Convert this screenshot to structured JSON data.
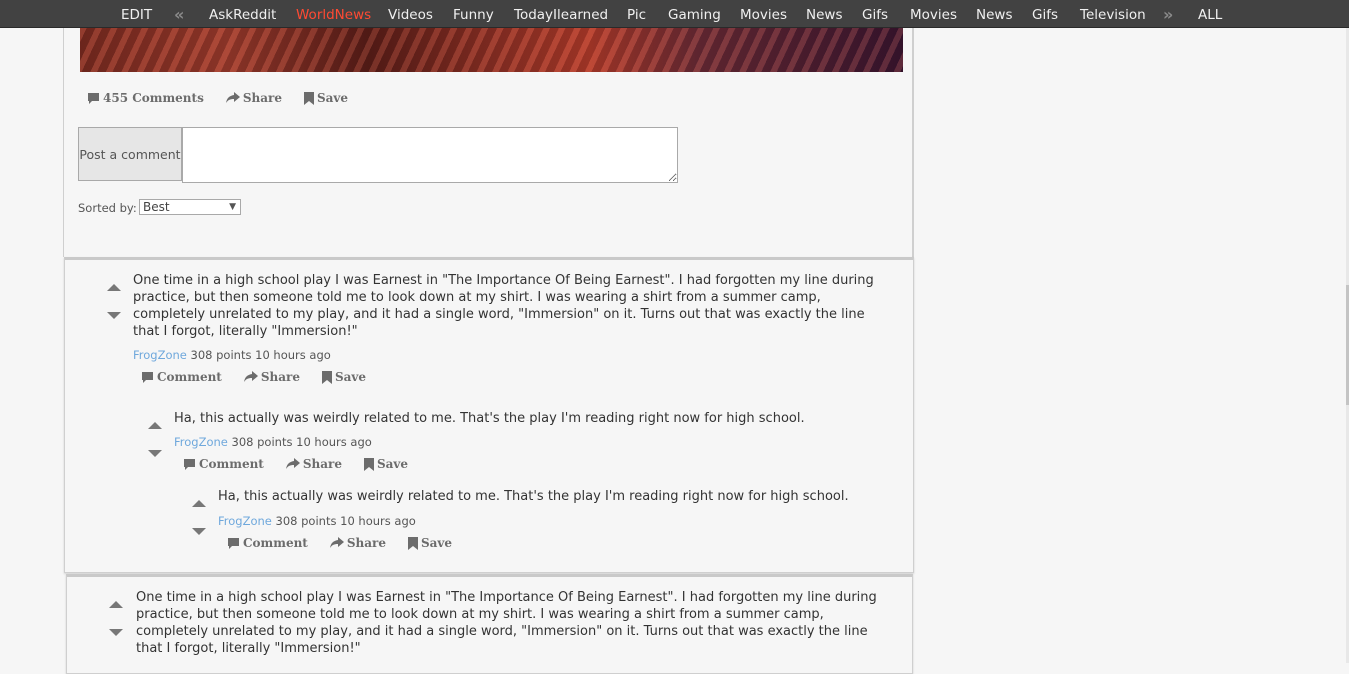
{
  "nav": {
    "edit": "EDIT",
    "prev_icon": "double-chevron-left-icon",
    "items": [
      "AskReddit",
      "WorldNews",
      "Videos",
      "Funny",
      "TodayIlearned",
      "Pic",
      "Gaming",
      "Movies",
      "News",
      "Gifs",
      "Movies",
      "News",
      "Gifs",
      "Television"
    ],
    "active_index": 1,
    "next_icon": "double-chevron-right-icon",
    "all": "ALL"
  },
  "post": {
    "actions": {
      "comments": "455 Comments",
      "share": "Share",
      "save": "Save"
    },
    "post_button": "Post a comment",
    "comment_placeholder": "",
    "sort_label": "Sorted by:",
    "sort_value": "Best"
  },
  "comments": [
    {
      "text": "One time in a high school play I was Earnest in \"The Importance Of Being Earnest\". I had forgotten my line during practice, but then someone told me to look down at my shirt. I was wearing a shirt from a summer camp, completely unrelated to my play, and it had a single word, \"Immersion\" on it. Turns out that was exactly the line that I forgot, literally \"Immersion!\"",
      "author": "FrogZone",
      "points": "308 points",
      "time": "10 hours ago",
      "actions": {
        "comment": "Comment",
        "share": "Share",
        "save": "Save"
      },
      "replies": [
        {
          "text": "Ha, this actually was weirdly related to me. That's the play I'm reading right now for high school.",
          "author": "FrogZone",
          "points": "308 points",
          "time": "10 hours ago",
          "actions": {
            "comment": "Comment",
            "share": "Share",
            "save": "Save"
          },
          "replies": [
            {
              "text": "Ha, this actually was weirdly related to me. That's the play I'm reading right now for high school.",
              "author": "FrogZone",
              "points": "308 points",
              "time": "10 hours ago",
              "actions": {
                "comment": "Comment",
                "share": "Share",
                "save": "Save"
              }
            }
          ]
        }
      ]
    },
    {
      "text": "One time in a high school play I was Earnest in \"The Importance Of Being Earnest\". I had forgotten my line during practice, but then someone told me to look down at my shirt. I was wearing a shirt from a summer camp, completely unrelated to my play, and it had a single word, \"Immersion\" on it. Turns out that was exactly the line that I forgot, literally \"Immersion!\""
    }
  ]
}
